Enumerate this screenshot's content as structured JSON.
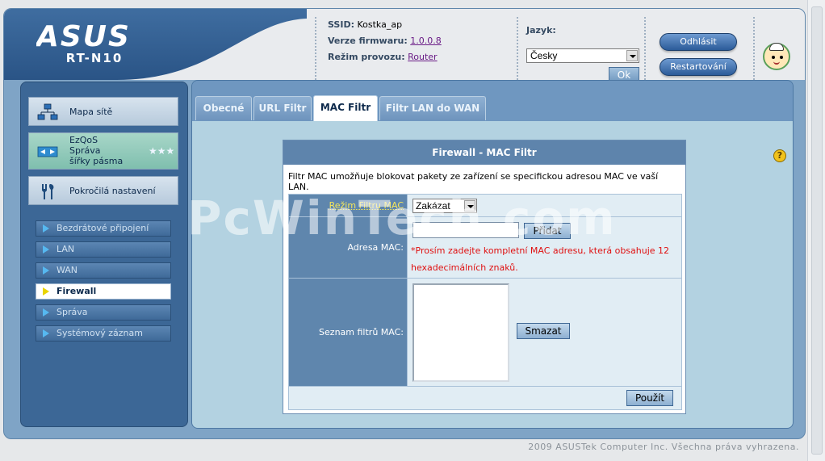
{
  "header": {
    "brand": "ASUS",
    "model": "RT-N10",
    "ssid_key": "SSID:",
    "ssid_value": "Kostka_ap",
    "firmware_key": "Verze firmwaru:",
    "firmware_value": "1.0.0.8",
    "mode_key": "Režim provozu:",
    "mode_value": "Router",
    "language_label": "Jazyk:",
    "language_value": "Česky",
    "ok_label": "Ok",
    "logout_label": "Odhlásit",
    "restart_label": "Restartování",
    "avatar_icon": "avatar-icon"
  },
  "sidebar": {
    "main_items": [
      {
        "label": "Mapa sítě",
        "icon": "network-map-icon"
      },
      {
        "label_lines": [
          "EzQoS",
          "Správa",
          "šířky pásma"
        ],
        "icon": "bandwidth-icon"
      },
      {
        "label": "Pokročilá nastavení",
        "icon": "tools-icon"
      }
    ],
    "sub_items": [
      {
        "label": "Bezdrátové připojení",
        "active": false
      },
      {
        "label": "LAN",
        "active": false
      },
      {
        "label": "WAN",
        "active": false
      },
      {
        "label": "Firewall",
        "active": true
      },
      {
        "label": "Správa",
        "active": false
      },
      {
        "label": "Systémový záznam",
        "active": false
      }
    ]
  },
  "tabs": [
    {
      "label": "Obecné",
      "active": false
    },
    {
      "label": "URL Filtr",
      "active": false
    },
    {
      "label": "MAC Filtr",
      "active": true
    },
    {
      "label": "Filtr LAN do WAN",
      "active": false
    }
  ],
  "panel": {
    "title": "Firewall - MAC Filtr",
    "description": "Filtr MAC umožňuje blokovat pakety ze zařízení se specifickou adresou MAC ve vaší LAN.",
    "mode_label": "Režim Filtru MAC",
    "mode_value": "Zakázat",
    "mac_label": "Adresa MAC:",
    "mac_value": "",
    "add_label": "Přidat",
    "warning": "*Prosím zadejte kompletní MAC adresu, která obsahuje 12 hexadecimálních znaků.",
    "list_label": "Seznam filtrů MAC:",
    "delete_label": "Smazat",
    "apply_label": "Použít",
    "help_symbol": "?"
  },
  "footer": {
    "copyright": "2009 ASUSTek Computer Inc. Všechna práva vyhrazena."
  },
  "watermark": "PcWinTech.com",
  "colors": {
    "brand_blue": "#2a5486",
    "sidebar_bg": "#3c6796",
    "panel_title": "#5e84ac",
    "warning": "#e01010",
    "mode_label": "#f6e65a"
  }
}
